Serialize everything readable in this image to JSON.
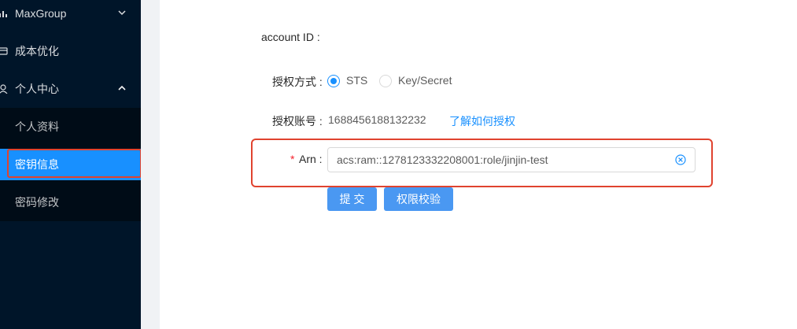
{
  "sidebar": {
    "items": [
      {
        "label": "MaxGroup",
        "icon": "bar-chart-icon",
        "arrow": "⌄"
      },
      {
        "label": "成本优化",
        "icon": "wallet-icon"
      },
      {
        "label": "个人中心",
        "icon": "user-icon",
        "arrow": "⌃"
      }
    ],
    "submenu": [
      {
        "label": "个人资料"
      },
      {
        "label": "密钥信息",
        "active": true
      },
      {
        "label": "密码修改"
      }
    ]
  },
  "form": {
    "account_id_label": "account ID :",
    "auth_method_label": "授权方式 :",
    "auth_method_options": [
      {
        "label": "STS",
        "checked": true
      },
      {
        "label": "Key/Secret",
        "checked": false
      }
    ],
    "auth_account_label": "授权账号 :",
    "auth_account_value": "1688456188132232",
    "auth_help_link": "了解如何授权",
    "arn_required_mark": "*",
    "arn_label": "Arn :",
    "arn_value": "acs:ram::1278123332208001:role/jinjin-test",
    "submit_label": "提 交",
    "verify_label": "权限校验"
  },
  "colors": {
    "sidebar_bg": "#001529",
    "submenu_bg": "#000c17",
    "primary": "#1890ff",
    "highlight_border": "#e0432f",
    "required": "#f5222d"
  }
}
